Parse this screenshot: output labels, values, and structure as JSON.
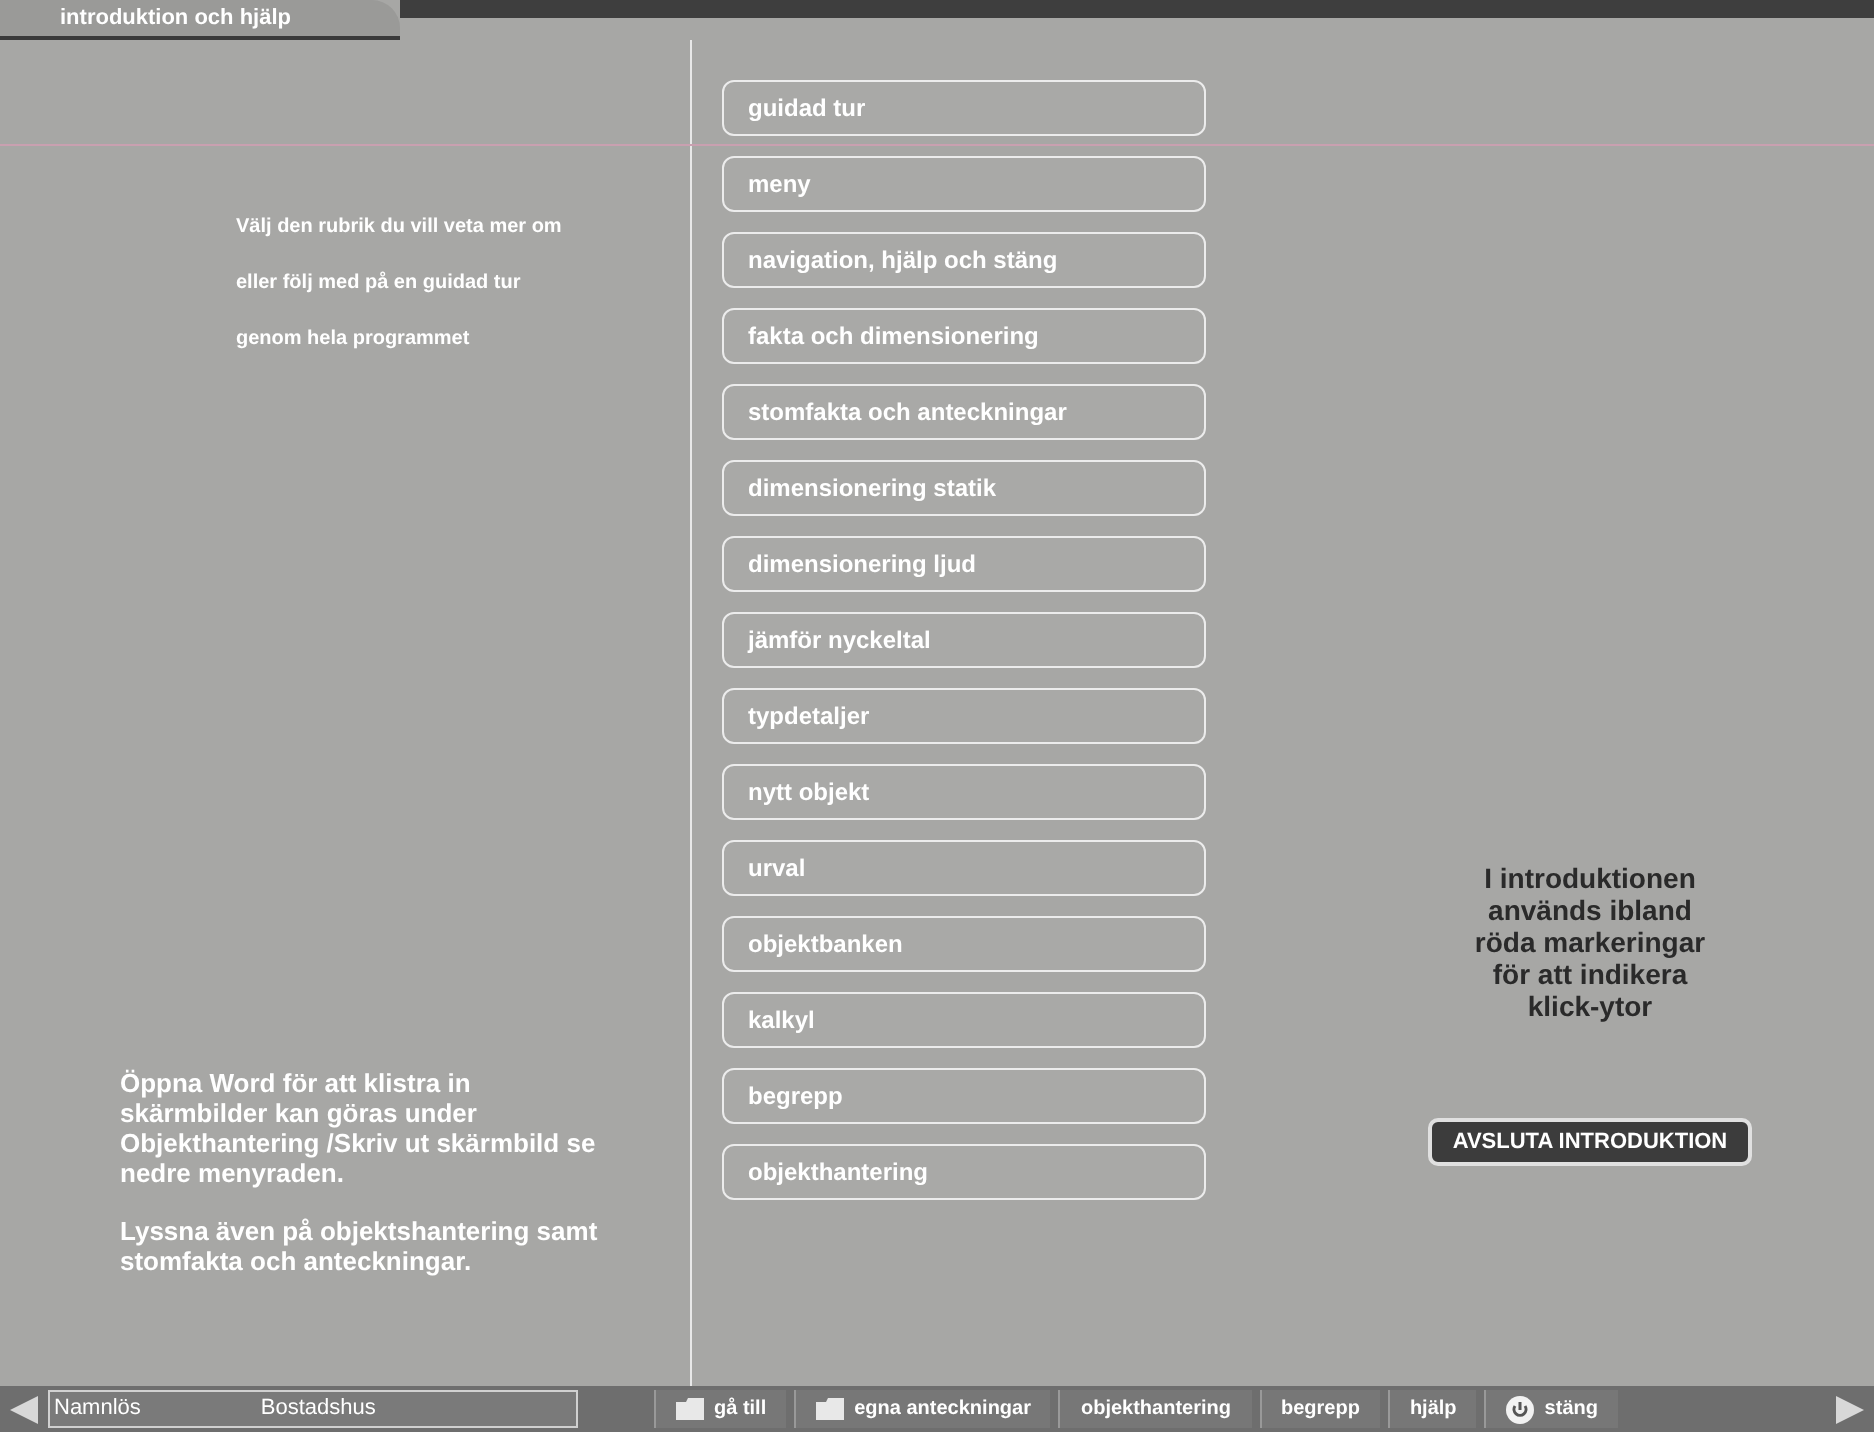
{
  "window": {
    "title": "introduktion och hjälp"
  },
  "intro_lines": [
    "Välj den rubrik du vill veta mer om",
    "eller följ med på en guidad tur",
    "genom hela programmet"
  ],
  "menu": [
    {
      "label": "guidad tur"
    },
    {
      "label": "meny"
    },
    {
      "label": "navigation, hjälp och stäng"
    },
    {
      "label": "fakta och dimensionering"
    },
    {
      "label": "stomfakta och anteckningar"
    },
    {
      "label": "dimensionering statik"
    },
    {
      "label": "dimensionering ljud"
    },
    {
      "label": "jämför nyckeltal"
    },
    {
      "label": "typdetaljer"
    },
    {
      "label": "nytt objekt"
    },
    {
      "label": "urval"
    },
    {
      "label": "objektbanken"
    },
    {
      "label": "kalkyl"
    },
    {
      "label": "begrepp"
    },
    {
      "label": "objekthantering"
    }
  ],
  "left_notes": [
    "Öppna Word  för att klistra in skärmbilder kan göras under Objekthantering /Skriv ut skärmbild se nedre menyraden.",
    "Lyssna även på objektshantering samt stomfakta och anteckningar."
  ],
  "right_note": "I introduktionen används ibland röda markeringar för att indikera klick-ytor",
  "exit_button": "AVSLUTA INTRODUKTION",
  "status_bar": {
    "name": "Namnlös",
    "type": "Bostadshus",
    "buttons": [
      {
        "label": "gå till",
        "kind": "folder"
      },
      {
        "label": "egna anteckningar",
        "kind": "folder"
      },
      {
        "label": "objekthantering",
        "kind": "plain"
      },
      {
        "label": "begrepp",
        "kind": "plain"
      },
      {
        "label": "hjälp",
        "kind": "plain"
      },
      {
        "label": "stäng",
        "kind": "power"
      }
    ]
  }
}
